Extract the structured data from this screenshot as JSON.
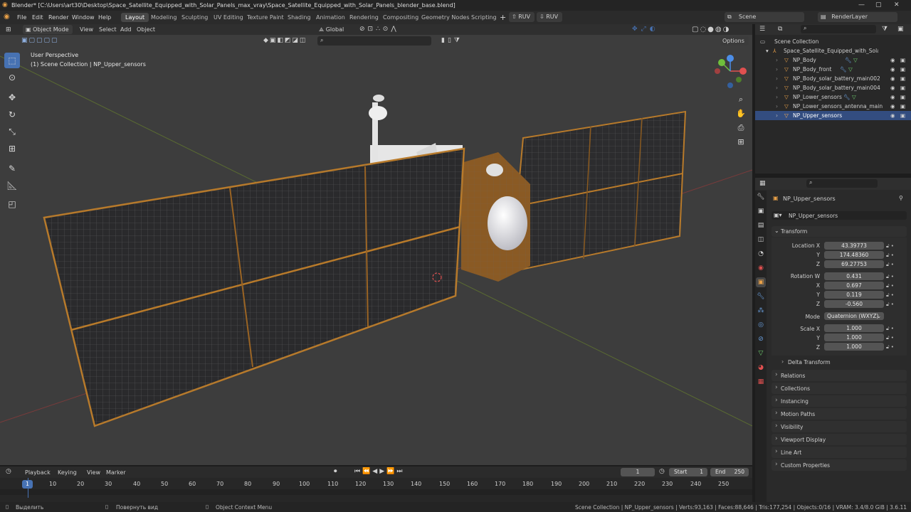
{
  "title": "Blender* [C:\\Users\\art30\\Desktop\\Space_Satellite_Equipped_with_Solar_Panels_max_vray\\Space_Satellite_Equipped_with_Solar_Panels_blender_base.blend]",
  "menu": [
    "File",
    "Edit",
    "Render",
    "Window",
    "Help"
  ],
  "workspaces": [
    "Layout",
    "Modeling",
    "Sculpting",
    "UV Editing",
    "Texture Paint",
    "Shading",
    "Animation",
    "Rendering",
    "Compositing",
    "Geometry Nodes",
    "Scripting"
  ],
  "ruv1": "RUV",
  "ruv2": "RUV",
  "scene": "Scene",
  "render_layer": "RenderLayer",
  "viewport": {
    "mode": "Object Mode",
    "menus": [
      "View",
      "Select",
      "Add",
      "Object"
    ],
    "orientation": "Global",
    "options": "Options",
    "info1": "User Perspective",
    "info2": "(1) Scene Collection | NP_Upper_sensors"
  },
  "outliner": {
    "root": "Scene Collection",
    "collection": "Space_Satellite_Equipped_with_Solar_Pa",
    "items": [
      "NP_Body",
      "NP_Body_front",
      "NP_Body_solar_battery_main002",
      "NP_Body_solar_battery_main004",
      "NP_Lower_sensors",
      "NP_Lower_sensors_antenna_main",
      "NP_Upper_sensors"
    ]
  },
  "props": {
    "object_name": "NP_Upper_sensors",
    "datablock": "NP_Upper_sensors",
    "transform": "Transform",
    "location_label": "Location X",
    "location": [
      "43.39773",
      "174.48360",
      "69.27753"
    ],
    "rotation_label": "Rotation W",
    "rotation": [
      "0.431",
      "0.697",
      "0.119",
      "-0.560"
    ],
    "mode_label": "Mode",
    "mode": "Quaternion (WXYZ)",
    "scale_label": "Scale X",
    "scale": [
      "1.000",
      "1.000",
      "1.000"
    ],
    "axis": [
      "X",
      "Y",
      "Z"
    ],
    "delta": "Delta Transform",
    "panels": [
      "Relations",
      "Collections",
      "Instancing",
      "Motion Paths",
      "Visibility",
      "Viewport Display",
      "Line Art",
      "Custom Properties"
    ]
  },
  "timeline": {
    "menus": [
      "Playback",
      "Keying",
      "View",
      "Marker"
    ],
    "current": "1",
    "start_label": "Start",
    "start": "1",
    "end_label": "End",
    "end": "250",
    "ticks": [
      "1",
      "10",
      "20",
      "30",
      "40",
      "50",
      "60",
      "70",
      "80",
      "90",
      "100",
      "110",
      "120",
      "130",
      "140",
      "150",
      "160",
      "170",
      "180",
      "190",
      "200",
      "210",
      "220",
      "230",
      "240",
      "250"
    ]
  },
  "status": {
    "select": "Выделить",
    "rotate": "Повернуть вид",
    "context": "Object Context Menu",
    "stats": "Scene Collection | NP_Upper_sensors | Verts:93,163 | Faces:88,646 | Tris:177,254 | Objects:0/16 | VRAM: 3.4/8.0 GiB | 3.6.11"
  },
  "colors": {
    "accent": "#4772b3",
    "orange": "#e8a048",
    "panel_gold": "#b87a2a"
  }
}
